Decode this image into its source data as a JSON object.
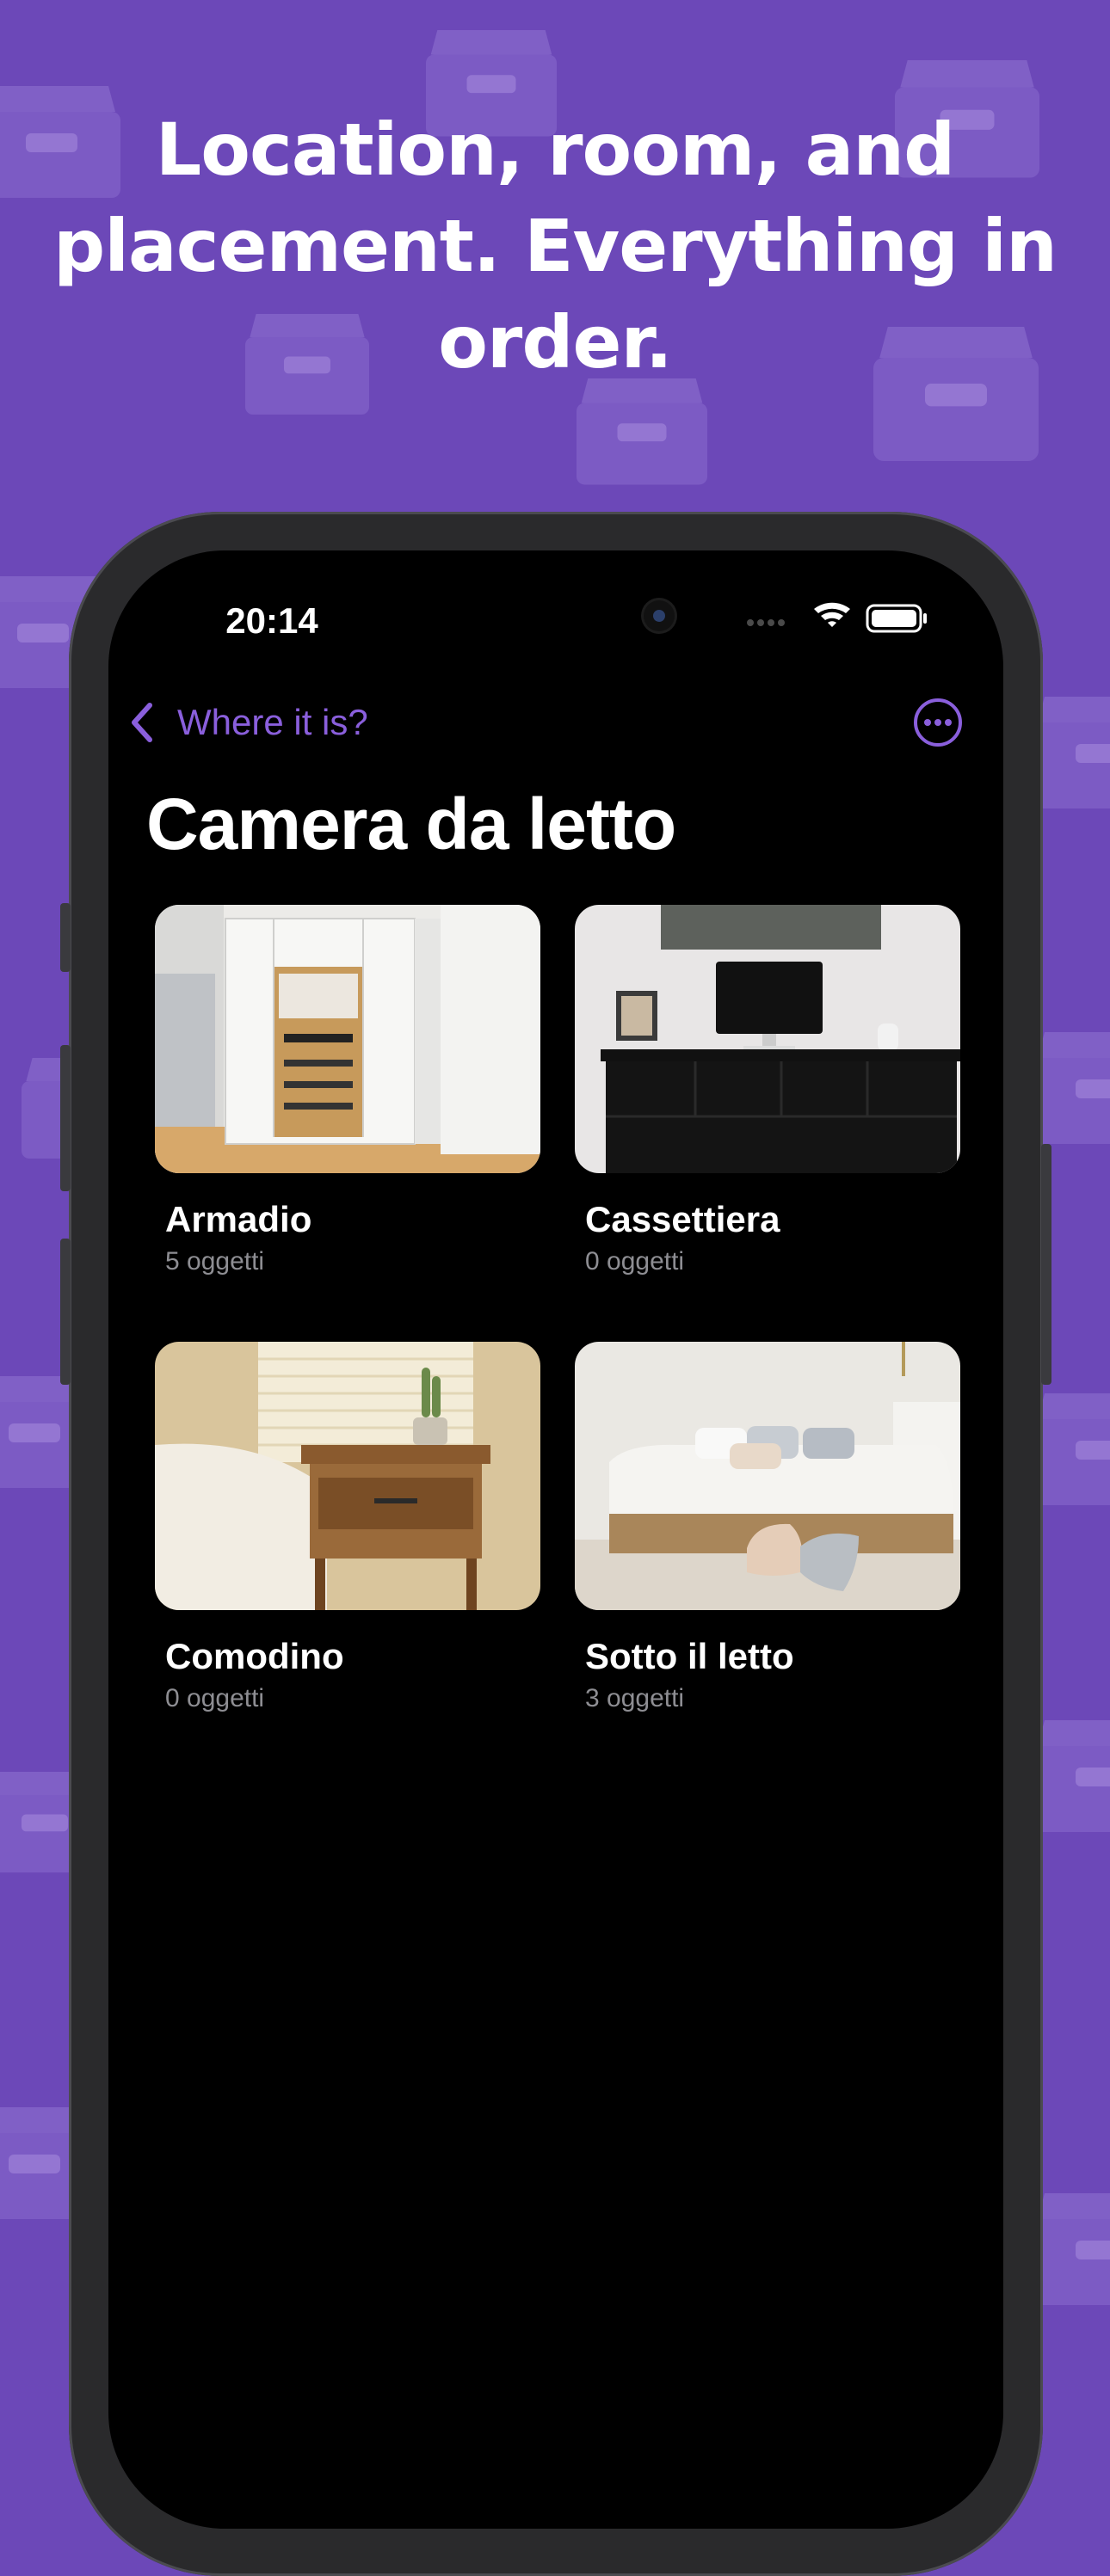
{
  "headline": {
    "line1": "Location, room, and",
    "line2": "placement. Everything in",
    "line3": "order."
  },
  "colors": {
    "background": "#6c48b8",
    "accent": "#8a5fdc",
    "screen": "#000000"
  },
  "status_bar": {
    "time": "20:14",
    "icons": [
      "cellular-icon",
      "wifi-icon",
      "battery-icon"
    ]
  },
  "nav": {
    "back_label": "Where it is?",
    "more_icon": "ellipsis-circle-icon"
  },
  "page": {
    "title": "Camera da letto"
  },
  "places": [
    {
      "name": "Armadio",
      "count": "5 oggetti",
      "image": "wardrobe-photo"
    },
    {
      "name": "Cassettiera",
      "count": "0 oggetti",
      "image": "dresser-photo"
    },
    {
      "name": "Comodino",
      "count": "0 oggetti",
      "image": "nightstand-photo"
    },
    {
      "name": "Sotto il letto",
      "count": "3 oggetti",
      "image": "bed-photo"
    }
  ]
}
